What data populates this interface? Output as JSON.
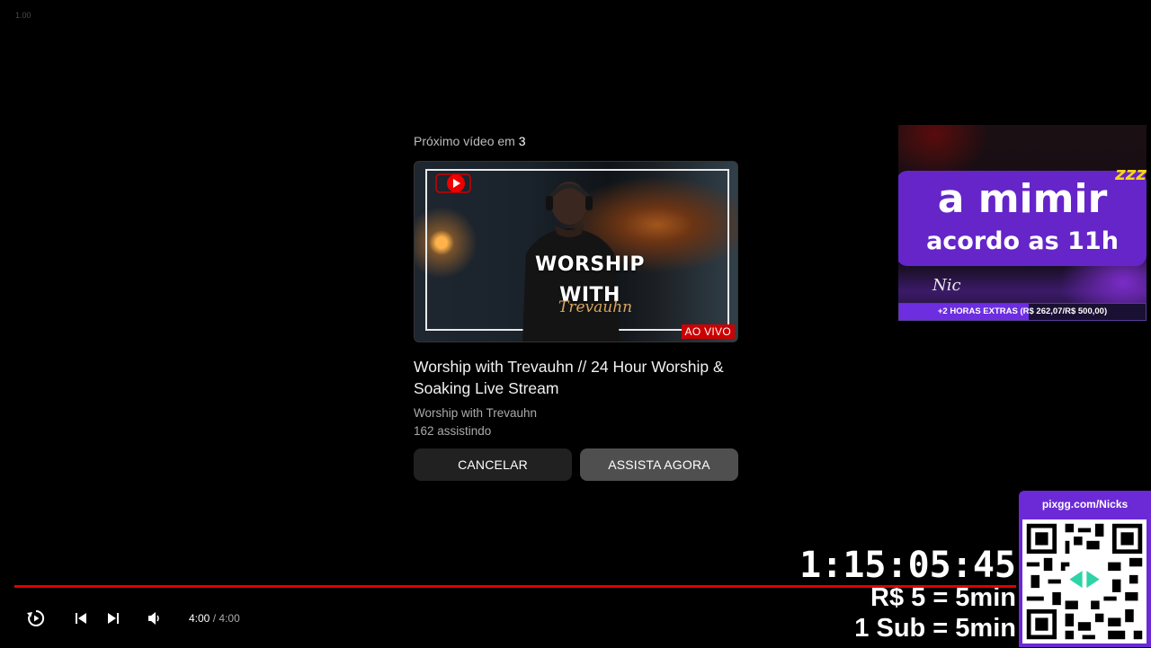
{
  "player": {
    "speed_label": "1.00",
    "current_time": "4:00",
    "separator": "/",
    "duration": "4:00",
    "progress": 1.0,
    "progress_color": "#e00000"
  },
  "up_next": {
    "heading": "Próximo vídeo em",
    "countdown": "3",
    "live_badge": "AO VIVO",
    "thumbnail_title_line1": "WORSHIP",
    "thumbnail_title_line2": "WITH",
    "thumbnail_signature": "Trevauhn",
    "video_title": "Worship with Trevauhn // 24 Hour Worship & Soaking Live Stream",
    "channel": "Worship with Trevauhn",
    "viewers": "162 assistindo",
    "cancel_label": "CANCELAR",
    "watch_label": "ASSISTA AGORA"
  },
  "overlay_sleep": {
    "line1": "a mimir",
    "line2": "acordo as 11h",
    "zzz": "zzz",
    "signature": "Nic",
    "goal_text": "+2 HORAS EXTRAS (R$ 262,07/R$ 500,00)",
    "goal_current": 262.07,
    "goal_target": 500.0,
    "accent": "#6525c9"
  },
  "overlay_timer": {
    "time": "1:15:05:45",
    "rate_donation": "R$ 5 = 5min",
    "rate_sub": "1 Sub = 5min"
  },
  "qr_panel": {
    "url": "pixgg.com/Nicks",
    "accent": "#6b2ad6"
  },
  "icons": {
    "replay": "replay-icon",
    "previous": "skip-previous-icon",
    "next": "skip-next-icon",
    "volume": "volume-icon"
  }
}
